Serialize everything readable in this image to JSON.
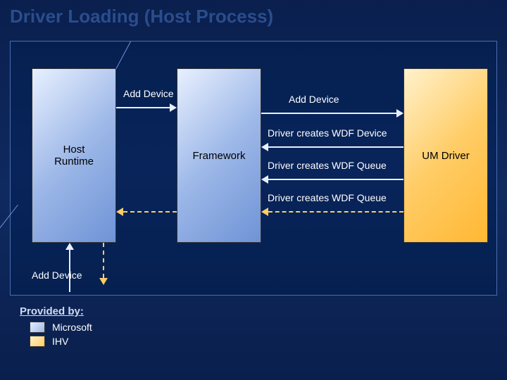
{
  "title": "Driver Loading (Host Process)",
  "boxes": {
    "host_runtime": "Host\nRuntime",
    "framework": "Framework",
    "um_driver": "UM Driver"
  },
  "flows": {
    "add_device_1": "Add Device",
    "add_device_2": "Add Device",
    "wdf_device": "Driver creates WDF Device",
    "wdf_queue_1": "Driver creates WDF Queue",
    "wdf_queue_2": "Driver creates WDF Queue",
    "add_device_ext": "Add Device"
  },
  "legend": {
    "title": "Provided by:",
    "microsoft": "Microsoft",
    "ihv": "IHV"
  }
}
